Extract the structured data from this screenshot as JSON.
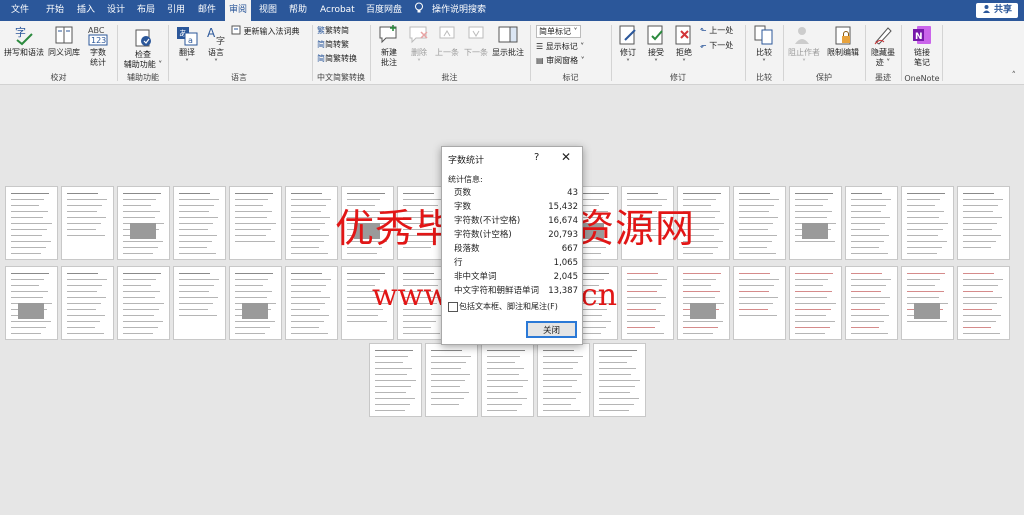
{
  "tabs": [
    "文件",
    "开始",
    "插入",
    "设计",
    "布局",
    "引用",
    "邮件",
    "审阅",
    "视图",
    "帮助",
    "Acrobat",
    "百度网盘"
  ],
  "active_tab": "审阅",
  "tell_me": "操作说明搜索",
  "share_label": "共享",
  "ribbon": {
    "proofing": {
      "label": "校对",
      "spelling": "拼写和语法",
      "thesaurus": "同义词库",
      "word_count_l1": "字数",
      "word_count_l2": "统计",
      "abc_text": "ABC",
      "num_text": "123"
    },
    "accessibility": {
      "label": "辅助功能",
      "check_l1": "检查",
      "check_l2": "辅助功能"
    },
    "language": {
      "label": "语言",
      "translate": "翻译",
      "language": "语言",
      "update_ime": "更新输入法词典"
    },
    "chinese_conversion": {
      "label": "中文简繁转换",
      "to_simplified": "繁转简",
      "to_traditional": "简转繁",
      "convert": "简繁转换"
    },
    "comments": {
      "label": "批注",
      "new": "新建",
      "new_l2": "批注",
      "delete": "删除",
      "previous": "上一条",
      "next": "下一条",
      "show": "显示批注"
    },
    "tracking": {
      "label": "修订",
      "track": "修订",
      "accept": "接受",
      "reject": "拒绝",
      "prev_change": "上一处",
      "next_change": "下一处"
    },
    "markup": {
      "label": "标记",
      "simple_markup": "简单标记",
      "show_markup": "显示标记",
      "review_pane": "审阅窗格"
    },
    "compare": {
      "label": "比较",
      "compare": "比较"
    },
    "protect": {
      "label": "保护",
      "block_authors": "阻止作者",
      "restrict": "限制编辑"
    },
    "ink": {
      "label": "墨迹",
      "hide_ink_l1": "隐藏墨",
      "hide_ink_l2": "迹"
    },
    "onenote": {
      "label": "OneNote",
      "linked_l1": "链接",
      "linked_l2": "笔记"
    }
  },
  "dialog": {
    "title": "字数统计",
    "help": "?",
    "close_x": "✕",
    "section": "统计信息:",
    "rows": [
      {
        "label": "页数",
        "value": "43"
      },
      {
        "label": "字数",
        "value": "15,432"
      },
      {
        "label": "字符数(不计空格)",
        "value": "16,674"
      },
      {
        "label": "字符数(计空格)",
        "value": "20,793"
      },
      {
        "label": "段落数",
        "value": "667"
      },
      {
        "label": "行",
        "value": "1,065"
      },
      {
        "label": "非中文单词",
        "value": "2,045"
      },
      {
        "label": "中文字符和朝鲜语单词",
        "value": "13,387"
      }
    ],
    "checkbox_label": "包括文本框、脚注和尾注(F)",
    "close_button": "关闭"
  },
  "watermark": {
    "line1": "优秀毕业设计资源网",
    "line2": "www.keyicad.cn"
  },
  "colors": {
    "titlebar": "#2b579a",
    "watermark": "#e21616",
    "accent": "#2b79d6"
  }
}
